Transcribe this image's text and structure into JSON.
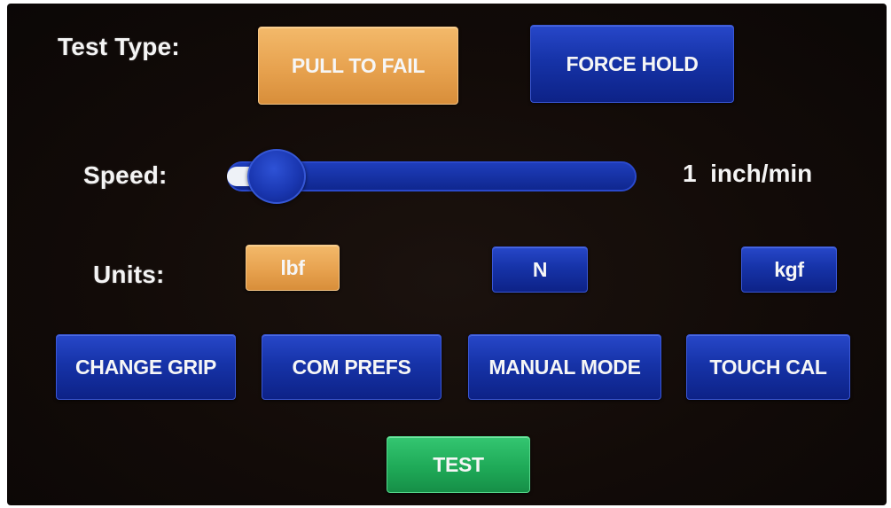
{
  "test_type": {
    "label": "Test Type:",
    "options": [
      "PULL TO FAIL",
      "FORCE HOLD"
    ],
    "selected": "PULL TO FAIL"
  },
  "speed": {
    "label": "Speed:",
    "value_text": "1  inch/min",
    "level_fraction": 0.0
  },
  "units": {
    "label": "Units:",
    "options": [
      "lbf",
      "N",
      "kgf"
    ],
    "selected": "lbf"
  },
  "actions": {
    "change_grip": "CHANGE GRIP",
    "com_prefs": "COM PREFS",
    "manual_mode": "MANUAL MODE",
    "touch_cal": "TOUCH CAL",
    "test": "TEST"
  },
  "colors": {
    "selected_button": "#e7a24f",
    "unselected_button": "#1633a8",
    "test_button": "#1faa58",
    "background": "#120b08"
  }
}
